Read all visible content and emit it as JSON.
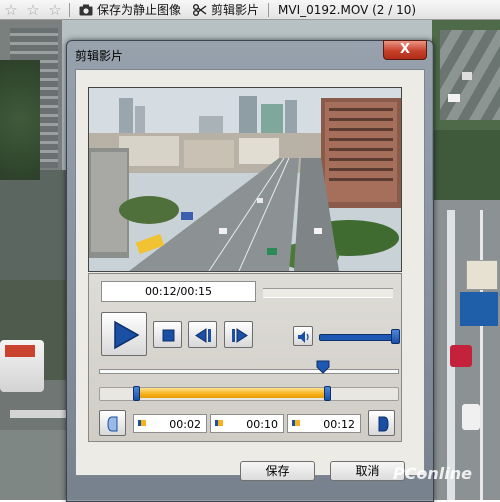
{
  "toolbar": {
    "save_still_label": "保存为静止图像",
    "edit_movie_label": "剪辑影片",
    "file_info": "MVI_0192.MOV (2 / 10)"
  },
  "dialog": {
    "title": "剪辑影片",
    "close_label": "X",
    "time_display": "00:12/00:15",
    "marks": [
      "00:02",
      "00:10",
      "00:12"
    ],
    "ok_label": "保存",
    "cancel_label": "取消"
  },
  "player": {
    "seek_position": 0.8,
    "range_start": 0.13,
    "range_end": 0.8,
    "volume": 1.0
  },
  "watermark": "PConline",
  "colors": {
    "accent_blue": "#1d58b4",
    "range_fill": "#f6b21b",
    "close_red": "#c7402a"
  }
}
